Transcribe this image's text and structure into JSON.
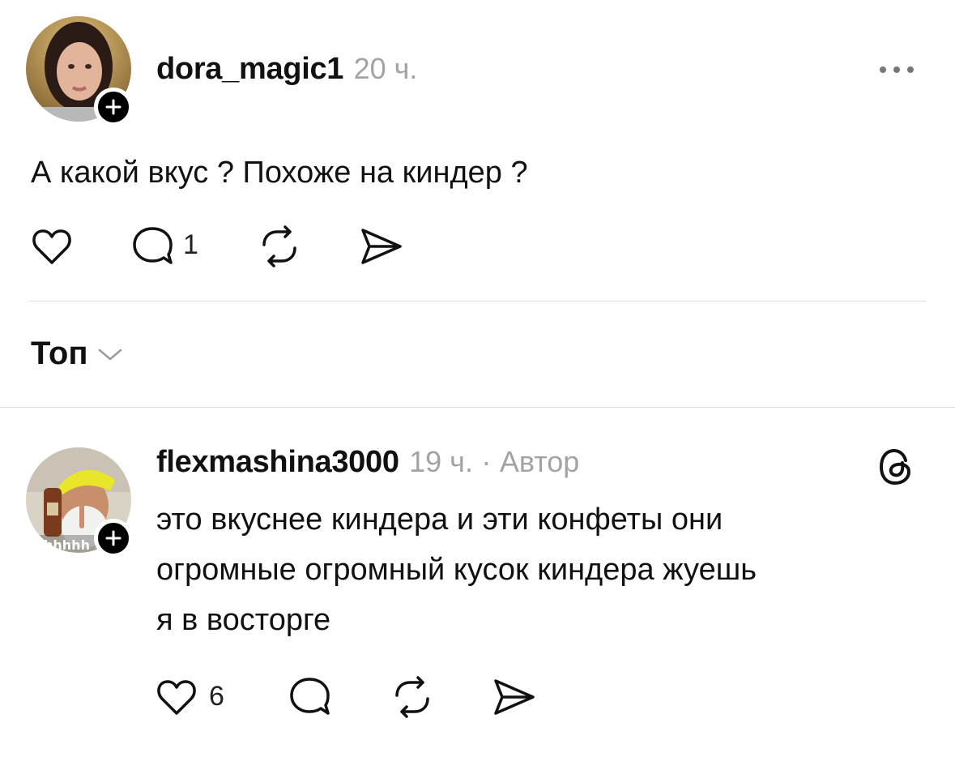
{
  "post": {
    "username": "dora_magic1",
    "time": "20 ч.",
    "text": "А какой вкус ? Похоже на киндер ?",
    "reply_count": "1",
    "avatar_icon": "user-avatar-photo",
    "menu_icon": "more-horizontal-icon"
  },
  "sort": {
    "label": "Топ",
    "icon": "chevron-down-icon"
  },
  "reply": {
    "username": "flexmashina3000",
    "time": "19 ч.",
    "separator": "·",
    "author_tag": "Автор",
    "avatar_overlay_text": "hhhhh",
    "text_lines": [
      "это вкуснее киндера и эти конфеты они",
      "огромные огромный кусок киндера жуешь",
      "я в восторге"
    ],
    "like_count": "6",
    "threads_icon": "threads-logo-icon"
  },
  "colors": {
    "text": "#111111",
    "muted": "#a3a3a3",
    "divider": "#dcdcdc",
    "badge": "#000000"
  }
}
